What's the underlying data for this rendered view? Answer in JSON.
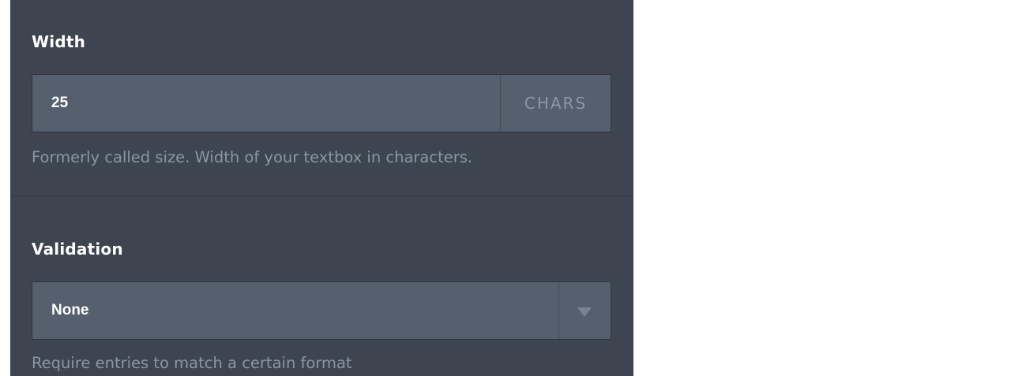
{
  "width_setting": {
    "label": "Width",
    "value": "25",
    "unit": "CHARS",
    "help": "Formerly called size. Width of your textbox in characters."
  },
  "validation_setting": {
    "label": "Validation",
    "selected": "None",
    "help": "Require entries to match a certain format",
    "arrow_icon": "caret-down-icon"
  },
  "colors": {
    "panel_background": "#3f4451",
    "input_background": "#555f6e",
    "label_text": "#ffffff",
    "help_text": "#8c95a3",
    "addon_text": "#8d96a4"
  }
}
